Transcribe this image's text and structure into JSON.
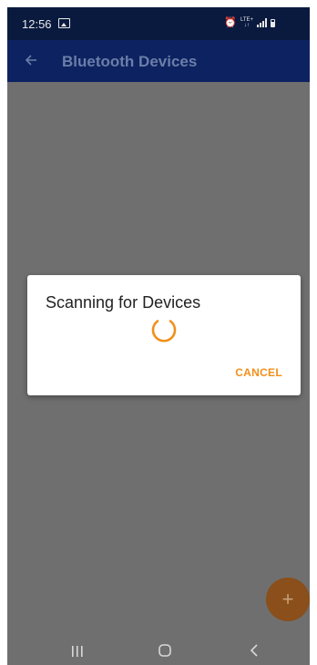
{
  "status_bar": {
    "time": "12:56",
    "left_icons": [
      "image-icon"
    ],
    "right_icons": [
      "alarm-icon",
      "lte-icon",
      "signal-icon",
      "battery-icon"
    ],
    "lte_label": "LTE+"
  },
  "app_bar": {
    "title": "Bluetooth Devices",
    "back_icon": "arrow-left-icon"
  },
  "dialog": {
    "title": "Scanning for Devices",
    "cancel_label": "CANCEL",
    "spinner_color": "#f0901a"
  },
  "fab": {
    "icon": "plus-icon",
    "label": "+"
  },
  "nav_bar": {
    "icons": [
      "recent-apps-icon",
      "home-icon",
      "back-icon"
    ]
  },
  "colors": {
    "app_bar": "#0d2260",
    "status_bar": "#0a1a3f",
    "accent": "#f0901a",
    "scrim": "#6f6f6f"
  }
}
